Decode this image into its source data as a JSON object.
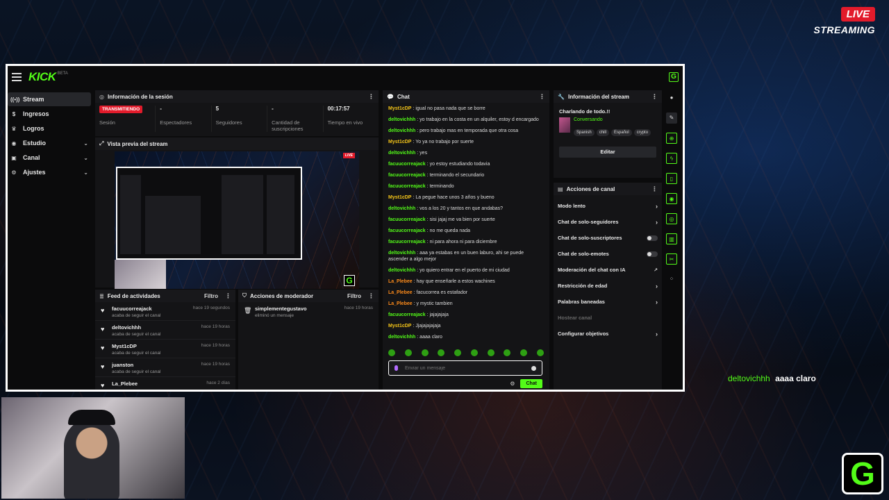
{
  "overlay": {
    "live_label": "LIVE",
    "streaming_label": "STREAMING",
    "chat_user": "deltovichhh",
    "chat_text": "aaaa claro",
    "logo_letter": "G"
  },
  "app": {
    "logo": "KICK",
    "beta": "BETA",
    "g_badge": "G"
  },
  "sidebar": {
    "items": [
      {
        "label": "Stream"
      },
      {
        "label": "Ingresos"
      },
      {
        "label": "Logros"
      },
      {
        "label": "Estudio"
      },
      {
        "label": "Canal"
      },
      {
        "label": "Ajustes"
      }
    ]
  },
  "session": {
    "title": "Información de la sesión",
    "status_badge": "TRANSMITIENDO",
    "stats": [
      {
        "value": "",
        "label": "Sesión"
      },
      {
        "value": "-",
        "label": "Espectadores"
      },
      {
        "value": "5",
        "label": "Seguidores"
      },
      {
        "value": "-",
        "label": "Cantidad de suscripciones"
      },
      {
        "value": "00:17:57",
        "label": "Tiempo en vivo"
      }
    ]
  },
  "preview": {
    "title": "Vista previa del stream",
    "live_mini": "LIVE",
    "g_mini": "G"
  },
  "feed": {
    "title": "Feed de actividades",
    "filter": "Filtro",
    "items": [
      {
        "name": "facuucorreajack",
        "action": "acaba de seguir el canal",
        "time": "hace 19 segundos"
      },
      {
        "name": "deltovichhh",
        "action": "acaba de seguir el canal",
        "time": "hace 19 horas"
      },
      {
        "name": "Myst1cDP",
        "action": "acaba de seguir el canal",
        "time": "hace 19 horas"
      },
      {
        "name": "juanston",
        "action": "acaba de seguir el canal",
        "time": "hace 19 horas"
      },
      {
        "name": "La_Plebee",
        "action": "",
        "time": "hace 2 días"
      }
    ]
  },
  "modactions": {
    "title": "Acciones de moderador",
    "filter": "Filtro",
    "items": [
      {
        "name": "simplementegustavo",
        "action": "eliminó un mensaje",
        "time": "hace 19 horas"
      }
    ]
  },
  "chat": {
    "title": "Chat",
    "placeholder": "Enviar un mensaje",
    "send_label": "Chat",
    "messages": [
      {
        "user": "Myst1cDP",
        "color": "#f5c518",
        "text": "igual no pasa nada que se borre"
      },
      {
        "user": "deltovichhh",
        "color": "#53fc18",
        "text": "yo trabajo en la costa en un alquiler, estoy d encargado"
      },
      {
        "user": "deltovichhh",
        "color": "#53fc18",
        "text": "pero trabajo mas en temporada que otra cosa"
      },
      {
        "user": "Myst1cDP",
        "color": "#f5c518",
        "text": "Yo ya no trabajo por suerte"
      },
      {
        "user": "deltovichhh",
        "color": "#53fc18",
        "text": "yes"
      },
      {
        "user": "facuucorreajack",
        "color": "#53fc18",
        "text": "yo estoy estudiando todavia"
      },
      {
        "user": "facuucorreajack",
        "color": "#53fc18",
        "text": "terminando el secundario"
      },
      {
        "user": "facuucorreajack",
        "color": "#53fc18",
        "text": "terminando"
      },
      {
        "user": "Myst1cDP",
        "color": "#f5c518",
        "text": "La pegue hace unos 3 años y bueno"
      },
      {
        "user": "deltovichhh",
        "color": "#53fc18",
        "text": "vos a los 20 y tantos en que andabas?"
      },
      {
        "user": "facuucorreajack",
        "color": "#53fc18",
        "text": "sisi jajaj me va bien por suerte"
      },
      {
        "user": "facuucorreajack",
        "color": "#53fc18",
        "text": "no me queda nada"
      },
      {
        "user": "facuucorreajack",
        "color": "#53fc18",
        "text": "ni para ahora ni para diciembre"
      },
      {
        "user": "deltovichhh",
        "color": "#53fc18",
        "text": "aaa ya estabas en un buen laburo, ahi se puede ascender a algo mejor"
      },
      {
        "user": "deltovichhh",
        "color": "#53fc18",
        "text": "yo quiero entrar en el puerto de mi ciudad"
      },
      {
        "user": "La_Plebee",
        "color": "#ff8c1a",
        "text": "hay que enseñarle a estos wachines"
      },
      {
        "user": "La_Plebee",
        "color": "#ff8c1a",
        "text": "facucorrea es estafador"
      },
      {
        "user": "La_Plebee",
        "color": "#ff8c1a",
        "text": "y mystic tambien"
      },
      {
        "user": "facuucorreajack",
        "color": "#53fc18",
        "text": "jajajajaja"
      },
      {
        "user": "Myst1cDP",
        "color": "#f5c518",
        "text": "Jjajajajajaja"
      },
      {
        "user": "deltovichhh",
        "color": "#53fc18",
        "text": "aaaa claro"
      }
    ]
  },
  "streaminfo": {
    "title": "Información del stream",
    "stream_title": "Charlando de todo.!!",
    "category": "Conversando",
    "tags": [
      "Spanish",
      "chill",
      "Español",
      "crypto"
    ],
    "edit_label": "Editar"
  },
  "channel": {
    "title": "Acciones de canal",
    "options": [
      {
        "label": "Modo lento",
        "kind": "arrow"
      },
      {
        "label": "Chat de solo-seguidores",
        "kind": "arrow"
      },
      {
        "label": "Chat de solo-suscriptores",
        "kind": "toggle"
      },
      {
        "label": "Chat de solo-emotes",
        "kind": "toggle"
      },
      {
        "label": "Moderación del chat con IA",
        "kind": "external"
      },
      {
        "label": "Restricción de edad",
        "kind": "arrow"
      },
      {
        "label": "Palabras baneadas",
        "kind": "arrow"
      },
      {
        "label": "Hostear canal",
        "kind": "dim"
      },
      {
        "label": "Configurar objetivos",
        "kind": "arrow"
      }
    ]
  },
  "colors": {
    "accent": "#53fc18",
    "live": "#e21b2b",
    "panel": "#141416"
  }
}
